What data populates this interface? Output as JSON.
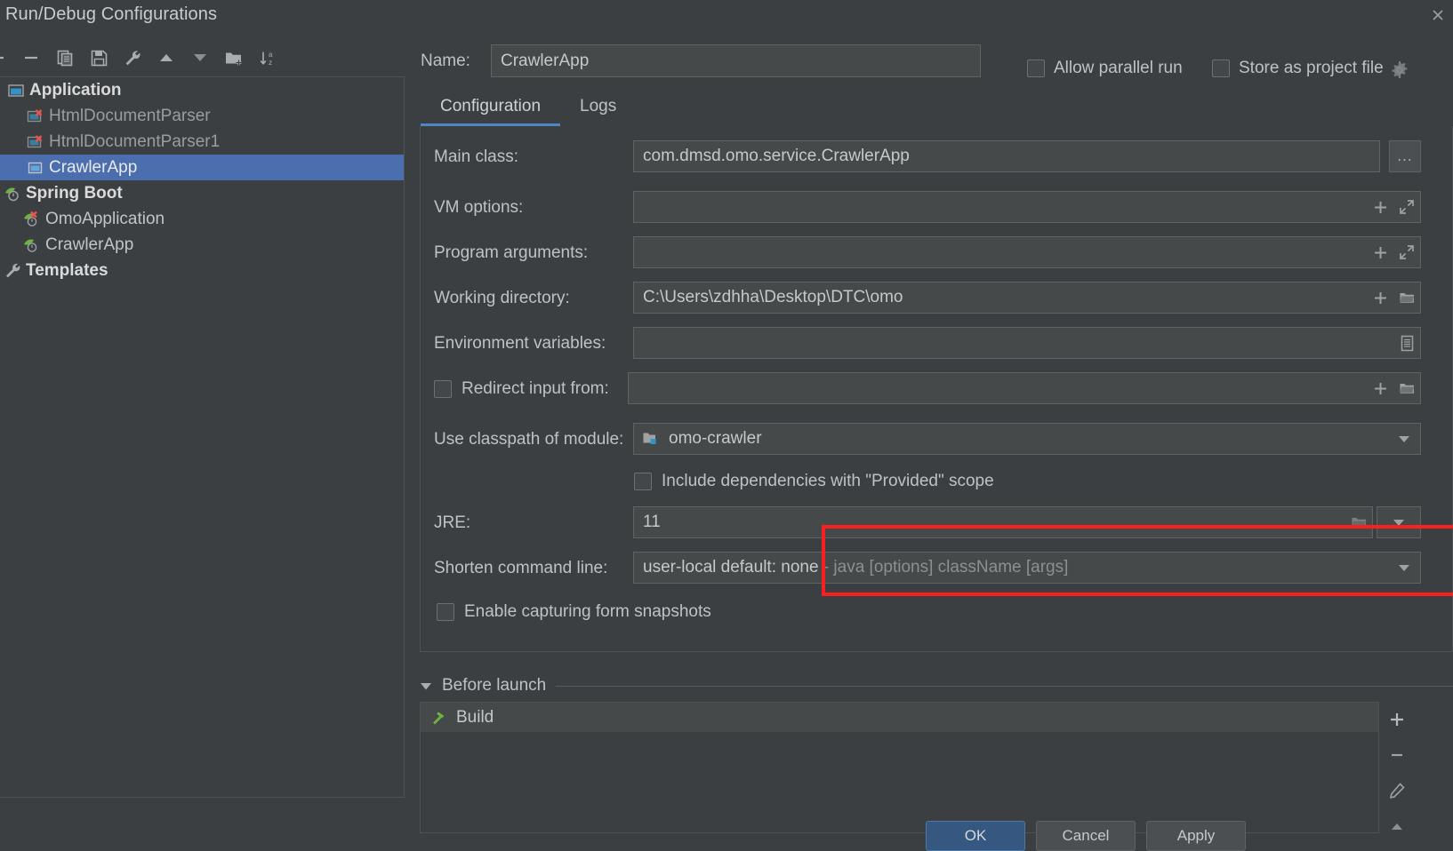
{
  "window": {
    "title": "Run/Debug Configurations",
    "close_icon": "close-icon"
  },
  "toolbar": {
    "items": [
      {
        "icon": "add-icon",
        "label": "Add New Configuration"
      },
      {
        "icon": "remove-icon",
        "label": "Remove Configuration"
      },
      {
        "icon": "copy-icon",
        "label": "Copy Configuration"
      },
      {
        "icon": "save-icon",
        "label": "Save Configuration"
      },
      {
        "icon": "edit-templates-icon",
        "label": "Edit Templates"
      },
      {
        "icon": "move-up-icon",
        "label": "Move Up"
      },
      {
        "icon": "move-down-icon",
        "label": "Move Down"
      },
      {
        "icon": "new-folder-icon",
        "label": "Create New Folder"
      },
      {
        "icon": "sort-alphabetically-icon",
        "label": "Sort Configurations"
      }
    ]
  },
  "tree": {
    "nodes": [
      {
        "label": "Application",
        "type": "group",
        "icon": "application-icon",
        "selected": false,
        "invalid": false
      },
      {
        "label": "HtmlDocumentParser",
        "type": "child",
        "icon": "application-error-icon",
        "selected": false,
        "invalid": true
      },
      {
        "label": "HtmlDocumentParser1",
        "type": "child",
        "icon": "application-error-icon",
        "selected": false,
        "invalid": true
      },
      {
        "label": "CrawlerApp",
        "type": "child",
        "icon": "application-icon",
        "selected": true,
        "invalid": false
      },
      {
        "label": "Spring Boot",
        "type": "group",
        "icon": "spring-boot-icon",
        "selected": false,
        "invalid": false
      },
      {
        "label": "OmoApplication",
        "type": "child",
        "icon": "spring-boot-error-icon",
        "selected": false,
        "invalid": false
      },
      {
        "label": "CrawlerApp",
        "type": "child",
        "icon": "spring-boot-icon",
        "selected": false,
        "invalid": false
      },
      {
        "label": "Templates",
        "type": "group",
        "icon": "wrench-icon",
        "selected": false,
        "invalid": false
      }
    ]
  },
  "header": {
    "name_label": "Name:",
    "name_value": "CrawlerApp",
    "name_placeholder": "",
    "allow_parallel_run": {
      "label": "Allow parallel run",
      "checked": false
    },
    "store_as_project_file": {
      "label": "Store as project file",
      "checked": false
    },
    "gear_icon": "gear-icon"
  },
  "tabs": [
    {
      "label": "Configuration",
      "active": true
    },
    {
      "label": "Logs",
      "active": false
    }
  ],
  "config": {
    "main_class": {
      "label": "Main class:",
      "value": "com.dmsd.omo.service.CrawlerApp",
      "browse_label": "..."
    },
    "vm_options": {
      "label": "VM options:",
      "value": "",
      "icons": [
        "plus-icon",
        "expand-icon"
      ]
    },
    "program_arguments": {
      "label": "Program arguments:",
      "value": "",
      "icons": [
        "plus-icon",
        "expand-icon"
      ]
    },
    "working_directory": {
      "label": "Working directory:",
      "value": "C:\\Users\\zdhha\\Desktop\\DTC\\omo",
      "icons": [
        "plus-icon",
        "folder-icon"
      ]
    },
    "environment_variables": {
      "label": "Environment variables:",
      "value": "",
      "icons": [
        "env-list-icon"
      ]
    },
    "redirect_input_from": {
      "label": "Redirect input from:",
      "checked": false,
      "value": "",
      "icons": [
        "plus-icon",
        "folder-icon"
      ]
    },
    "use_classpath_of_module": {
      "label": "Use classpath of module:",
      "value": "omo-crawler",
      "item_icon": "module-icon",
      "icons": [
        "chevron-down-icon"
      ]
    },
    "include_provided_dependencies": {
      "label": "Include dependencies with \"Provided\" scope",
      "checked": false
    },
    "jre": {
      "label": "JRE:",
      "value": "11",
      "icons": [
        "folder-icon",
        "chevron-down-icon"
      ],
      "highlighted": true,
      "highlight_color": "#fb2020"
    },
    "shorten_command_line": {
      "label": "Shorten command line:",
      "value": "user-local default: none",
      "value_hint": " - java [options] className [args]",
      "icons": [
        "chevron-down-icon"
      ]
    },
    "enable_capturing_form_snapshots": {
      "label": "Enable capturing form snapshots",
      "checked": false
    }
  },
  "before_launch": {
    "title": "Before launch",
    "expanded": true,
    "collapse_icon": "triangle-down-icon",
    "tasks": [
      {
        "label": "Build",
        "icon": "build-hammer-icon",
        "selected": true
      }
    ],
    "toolbar": [
      {
        "icon": "plus-icon",
        "label": "Add Task"
      },
      {
        "icon": "minus-icon",
        "label": "Remove Task"
      },
      {
        "icon": "pencil-icon",
        "label": "Edit Task"
      },
      {
        "icon": "move-up-icon",
        "label": "Move Up"
      }
    ]
  },
  "footer": {
    "ok_label": "OK",
    "cancel_label": "Cancel",
    "apply_label": "Apply"
  },
  "colors": {
    "background": "#3c3f41",
    "field_background": "#45494a",
    "selection_blue": "#4b6eaf",
    "tab_accent": "#4a88c7",
    "highlight_red": "#fb2020",
    "primary_button": "#365880",
    "text": "#bfc2c4"
  }
}
